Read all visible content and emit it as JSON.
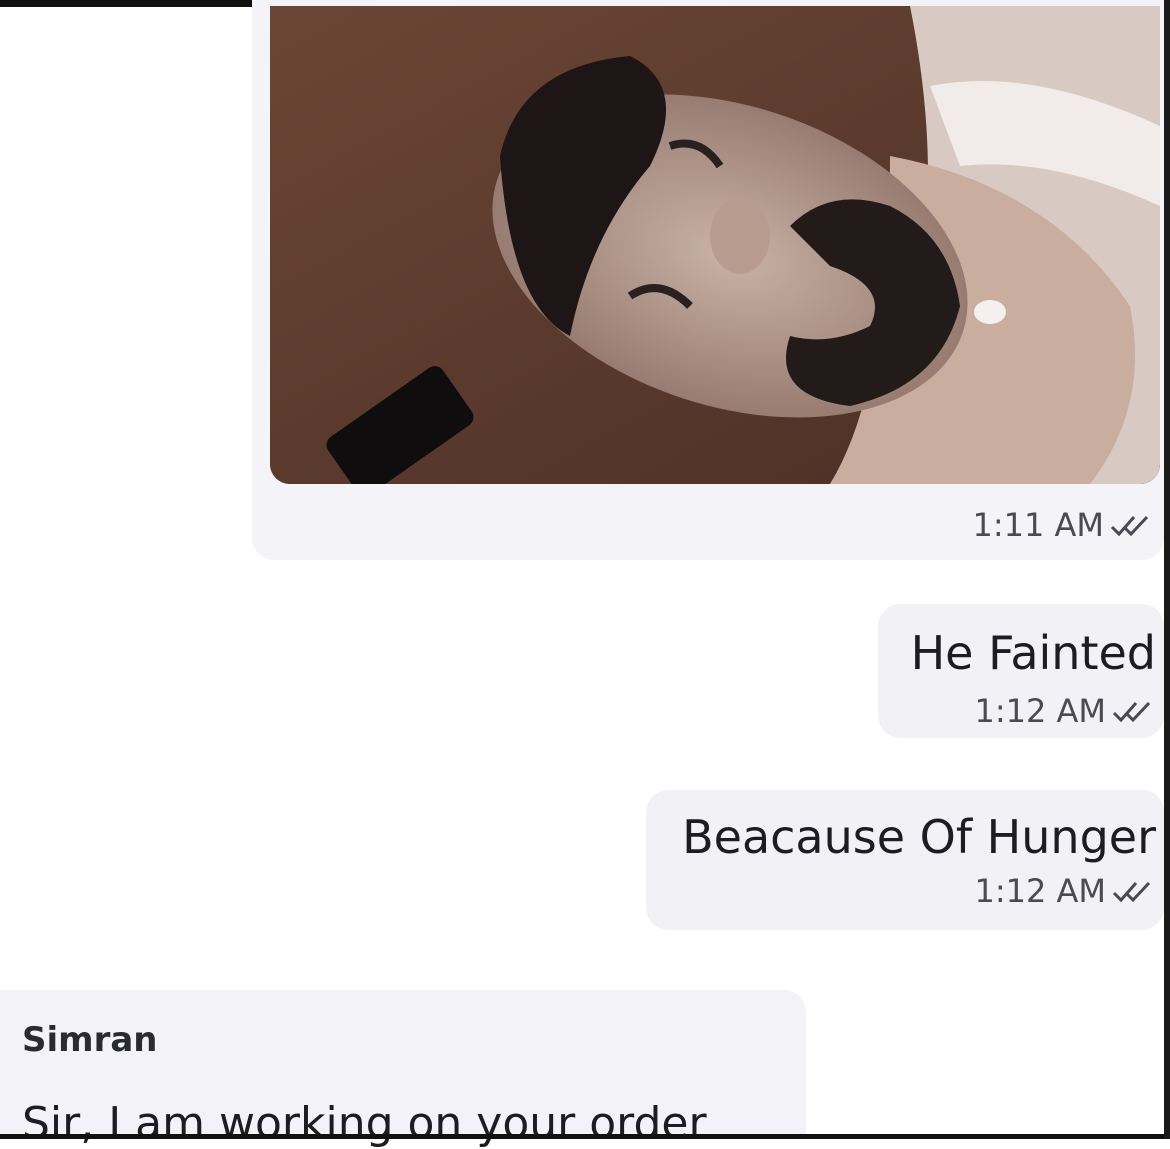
{
  "chat": {
    "messages": [
      {
        "type": "image",
        "direction": "outgoing",
        "time": "1:11 AM",
        "status_icon": "double-check-icon"
      },
      {
        "type": "text",
        "direction": "outgoing",
        "text": "He Fainted",
        "time": "1:12 AM",
        "status_icon": "double-check-icon"
      },
      {
        "type": "text",
        "direction": "outgoing",
        "text": "Beacause Of Hunger",
        "time": "1:12 AM",
        "status_icon": "double-check-icon"
      },
      {
        "type": "text",
        "direction": "incoming",
        "sender": "Simran",
        "text": "Sir, I am working on your order"
      }
    ]
  },
  "colors": {
    "outgoing_bubble": "#f2f2f6",
    "incoming_bubble": "#f2f2f8",
    "timestamp": "#4a4a52"
  }
}
